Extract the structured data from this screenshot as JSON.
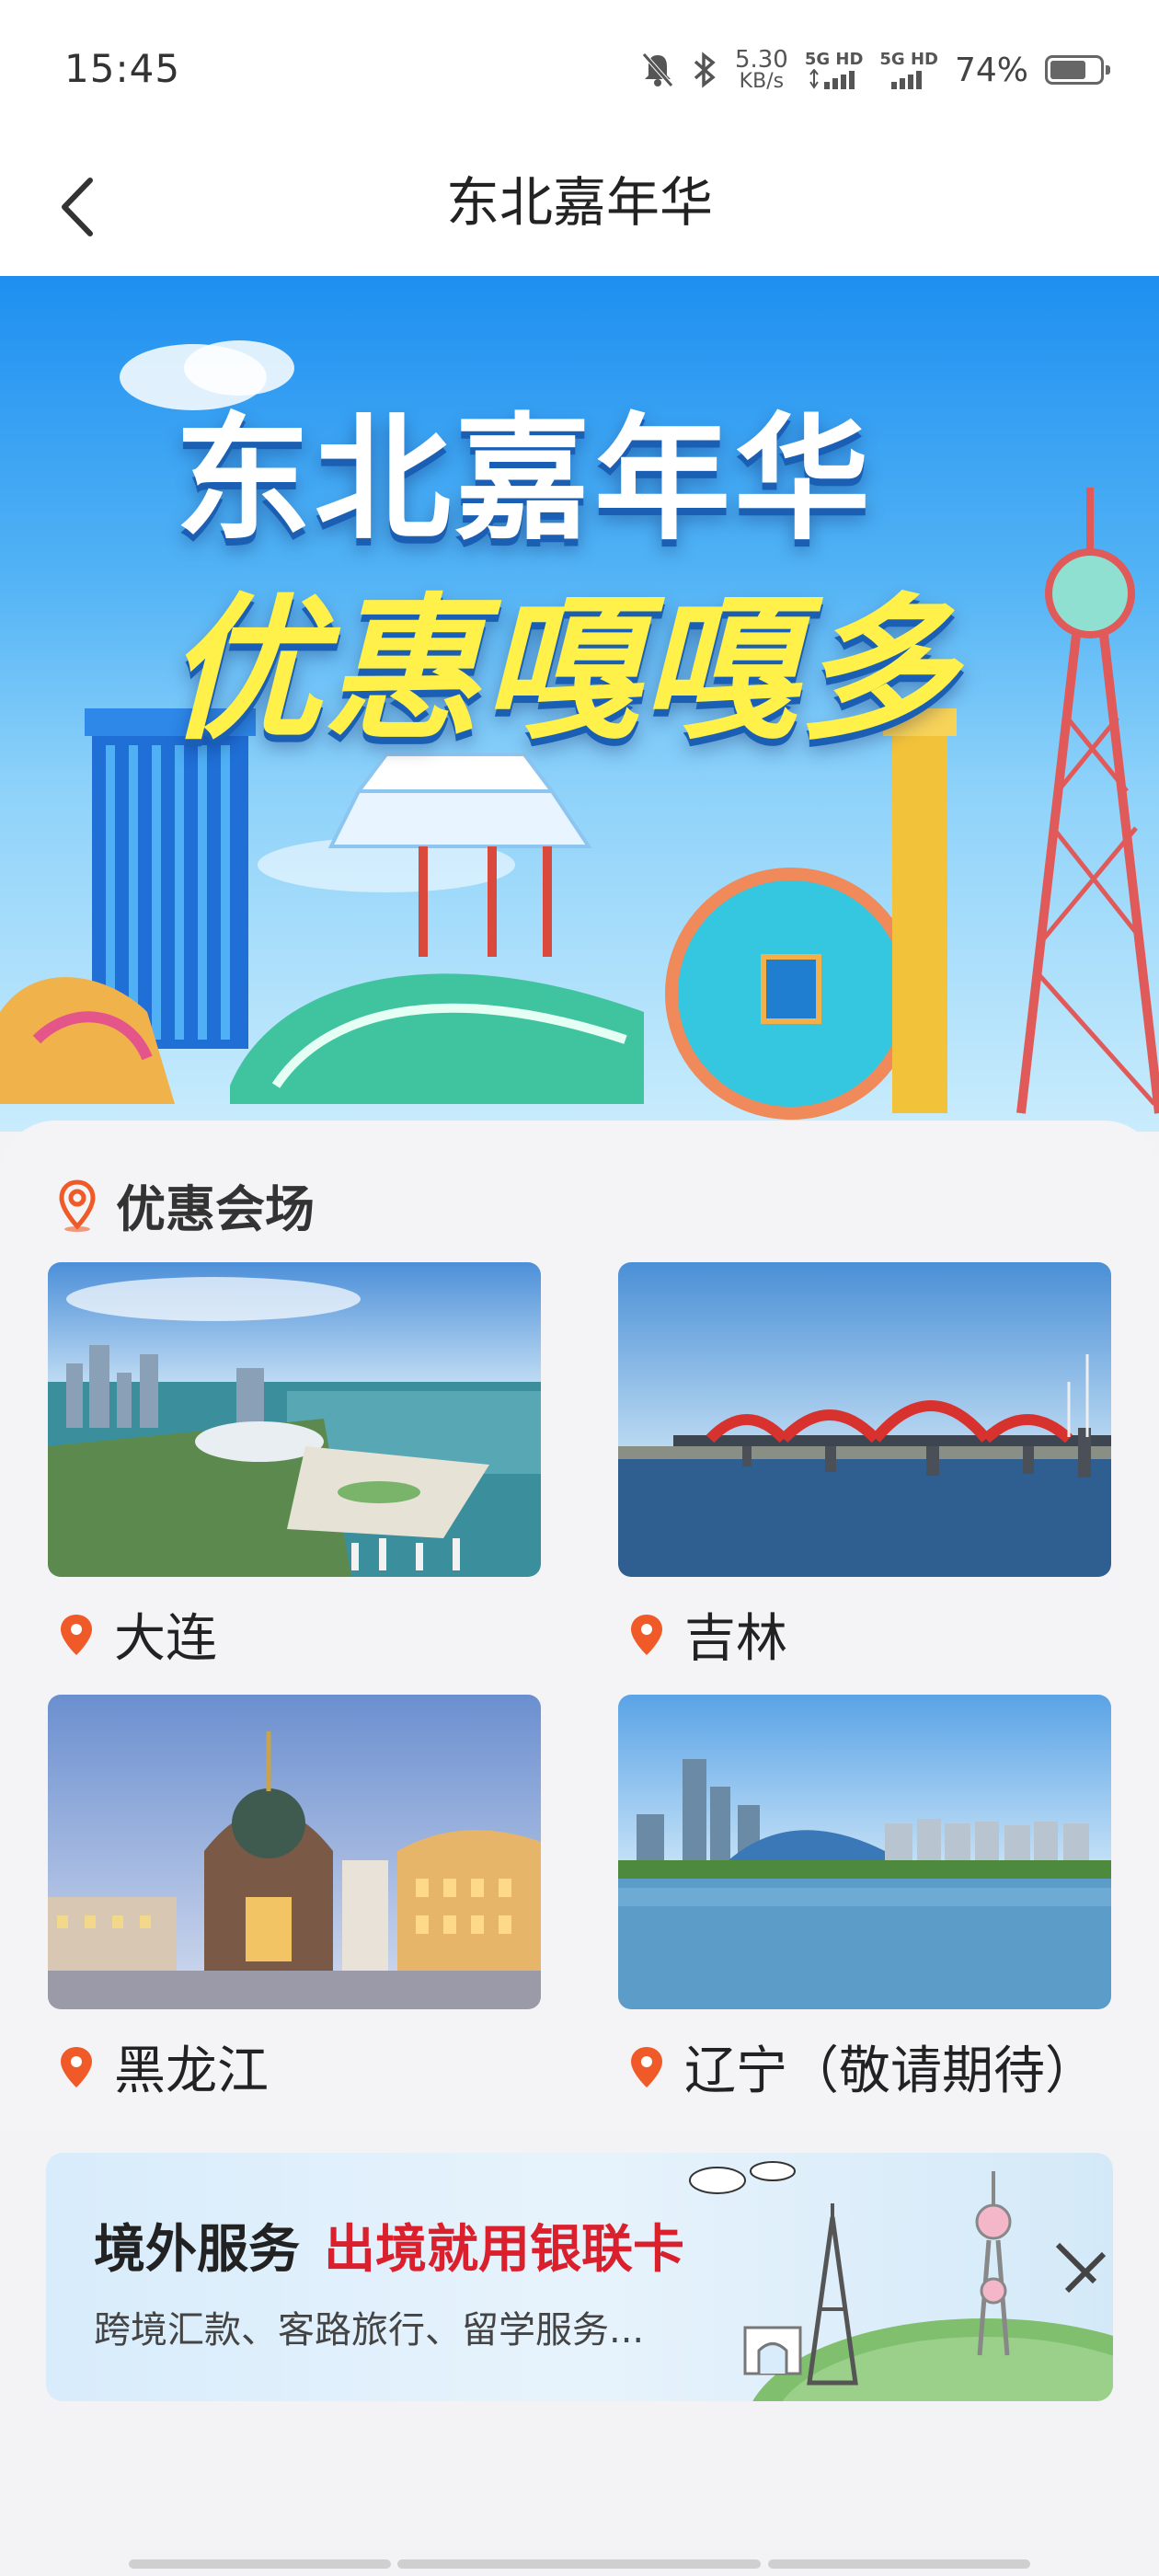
{
  "status_bar": {
    "time": "15:45",
    "net_speed_value": "5.30",
    "net_speed_unit": "KB/s",
    "sim1_label": "5G HD",
    "sim2_label": "5G HD",
    "battery_percent": "74%",
    "battery_level": 0.74
  },
  "header": {
    "title": "东北嘉年华"
  },
  "banner": {
    "title": "东北嘉年华",
    "subtitle": "优惠嘎嘎多"
  },
  "venue": {
    "section_title": "优惠会场",
    "cities": [
      {
        "name": "大连"
      },
      {
        "name": "吉林"
      },
      {
        "name": "黑龙江"
      },
      {
        "name": "辽宁（敬请期待）"
      }
    ]
  },
  "overseas": {
    "title": "境外服务",
    "highlight": "出境就用银联卡",
    "description": "跨境汇款、客路旅行、留学服务..."
  },
  "colors": {
    "accent_red": "#d9202c",
    "pin_orange": "#f05a28",
    "banner_blue": "#1e8ff0",
    "banner_yellow": "#fff04a"
  }
}
